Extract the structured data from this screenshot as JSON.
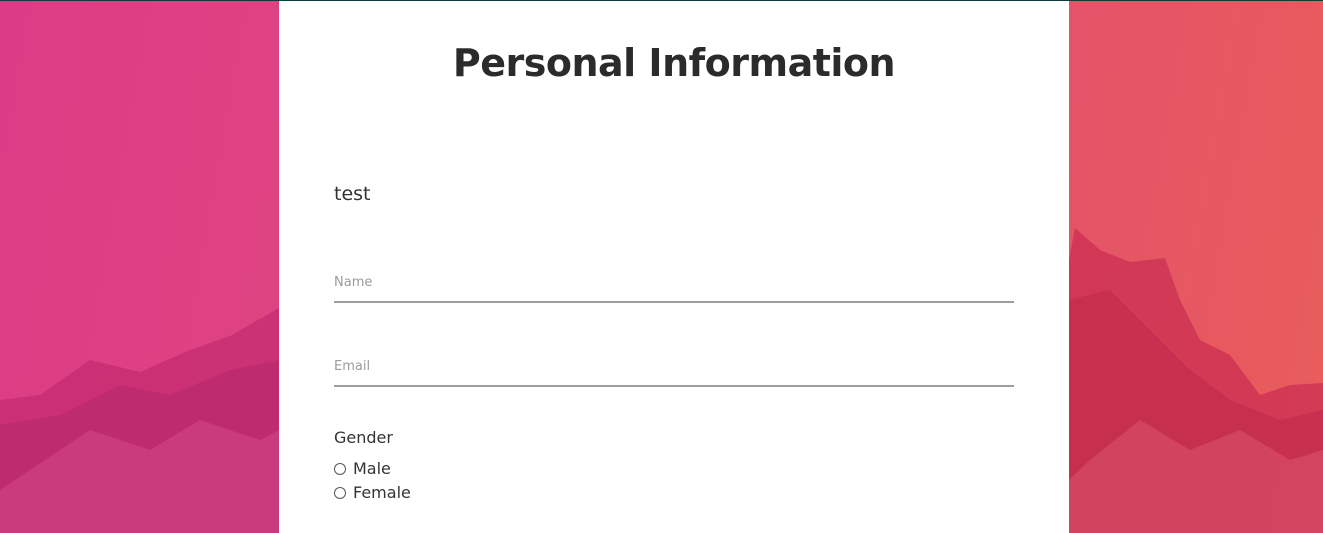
{
  "form": {
    "title": "Personal Information",
    "section_text": "test",
    "name_field": {
      "placeholder": "Name",
      "value": ""
    },
    "email_field": {
      "placeholder": "Email",
      "value": ""
    },
    "gender": {
      "label": "Gender",
      "options": [
        "Male",
        "Female"
      ],
      "selected": null
    }
  },
  "colors": {
    "background_left": "#dc3c86",
    "background_right": "#e85d5a",
    "card": "#ffffff",
    "title_text": "#2b2b2b",
    "field_underline": "#9e9e9e"
  }
}
